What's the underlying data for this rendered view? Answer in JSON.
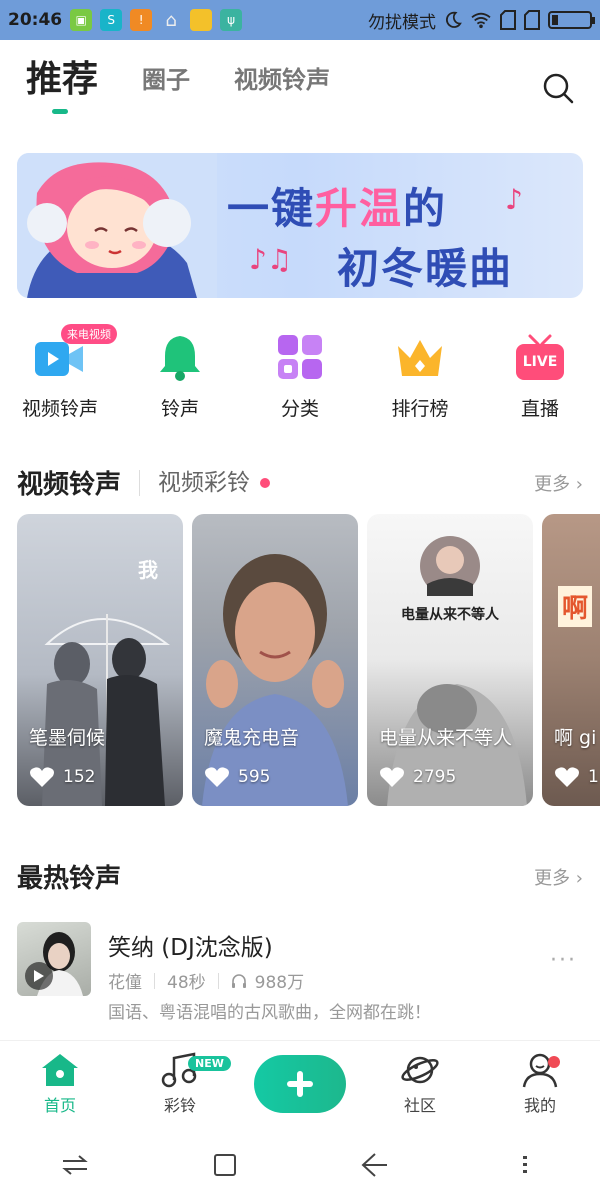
{
  "status_bar": {
    "time": "20:46",
    "mode": "勿扰模式"
  },
  "tabs": [
    {
      "label": "推荐",
      "active": true
    },
    {
      "label": "圈子",
      "active": false
    },
    {
      "label": "视频铃声",
      "active": false
    }
  ],
  "banner": {
    "line1_a": "一键",
    "line1_hl": "升温",
    "line1_b": "的",
    "line2": "初冬暖曲"
  },
  "categories": [
    {
      "label": "视频铃声",
      "icon": "video-camera-icon",
      "badge": "来电视频"
    },
    {
      "label": "铃声",
      "icon": "bell-icon"
    },
    {
      "label": "分类",
      "icon": "grid-icon"
    },
    {
      "label": "排行榜",
      "icon": "crown-icon"
    },
    {
      "label": "直播",
      "icon": "live-tv-icon",
      "icon_text": "LIVE"
    }
  ],
  "video_section": {
    "title": "视频铃声",
    "subtitle": "视频彩铃",
    "more": "更多 ›"
  },
  "video_cards": [
    {
      "title": "笔墨伺候",
      "likes": "152",
      "overlay": "我"
    },
    {
      "title": "魔鬼充电音",
      "likes": "595"
    },
    {
      "title": "电量从来不等人",
      "likes": "2795",
      "overlay": "电量从来不等人"
    },
    {
      "title": "啊 gi",
      "likes": "1",
      "overlay": "啊"
    }
  ],
  "hot_section": {
    "title": "最热铃声",
    "more": "更多 ›"
  },
  "hot_song": {
    "name": "笑纳 (DJ沈念版)",
    "artist": "花僮",
    "duration": "48秒",
    "plays": "988万",
    "description": "国语、粤语混唱的古风歌曲，全网都在跳！",
    "menu": "···"
  },
  "bottom_nav": [
    {
      "label": "首页",
      "icon": "home-icon",
      "active": true
    },
    {
      "label": "彩铃",
      "icon": "music-note-icon",
      "badge": "NEW"
    },
    {
      "label": "",
      "icon": "plus-icon"
    },
    {
      "label": "社区",
      "icon": "planet-icon"
    },
    {
      "label": "我的",
      "icon": "profile-icon",
      "dot": true
    }
  ],
  "colors": {
    "accent": "#18b889",
    "pink": "#ff4d86",
    "statusbar": "#6f9cd9"
  }
}
